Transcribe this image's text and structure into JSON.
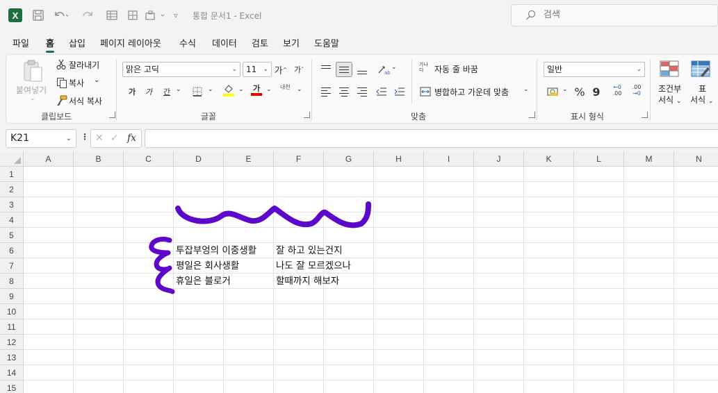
{
  "app": {
    "title": "통합 문서1  -  Excel",
    "logo_letter": "X",
    "search_placeholder": "검색"
  },
  "titlebar_icons": [
    "save-icon",
    "undo-icon",
    "redo-icon",
    "form-icon",
    "touch-mode-icon",
    "customize-icon"
  ],
  "tabs": [
    "파일",
    "홈",
    "삽입",
    "페이지 레이아웃",
    "수식",
    "데이터",
    "검토",
    "보기",
    "도움말"
  ],
  "active_tab": "홈",
  "ribbon": {
    "clipboard": {
      "paste": "붙여넣기",
      "cut": "잘라내기",
      "copy": "복사",
      "format_painter": "서식 복사",
      "label": "클립보드"
    },
    "font": {
      "font_name": "맑은 고딕",
      "font_size": "11",
      "grow": "가",
      "shrink": "가",
      "bold": "가",
      "italic": "가",
      "underline": "간",
      "font_color_glyph": "가",
      "phonetic": "내천",
      "label": "글꼴",
      "fill_color": "#ffff00",
      "font_color": "#e00000"
    },
    "alignment": {
      "wrap_text_glyph": "가나 다",
      "wrap_text": "자동 줄 바꿈",
      "merge_center": "병합하고 가운데 맞춤",
      "label": "맞춤"
    },
    "number": {
      "format": "일반",
      "percent": "%",
      "comma": "9",
      "inc_decimal": ".00",
      "dec_decimal": ".00",
      "label": "표시 형식"
    },
    "styles": {
      "conditional_line1": "조건부",
      "conditional_line2": "서식",
      "table_line1": "표",
      "table_line2": "서식"
    }
  },
  "formula_bar": {
    "name_box": "K21",
    "fx": "fx",
    "formula": ""
  },
  "grid": {
    "columns": [
      "A",
      "B",
      "C",
      "D",
      "E",
      "F",
      "G",
      "H",
      "I",
      "J",
      "K",
      "L",
      "M",
      "N"
    ],
    "rows": [
      "1",
      "2",
      "3",
      "4",
      "5",
      "6",
      "7",
      "8",
      "9",
      "10",
      "11",
      "12",
      "13",
      "14",
      "15"
    ],
    "cells": [
      {
        "ref": "D6",
        "text": "투잡부엉의 이중생활"
      },
      {
        "ref": "F6",
        "text": "잘 하고 있는건지"
      },
      {
        "ref": "D7",
        "text": "평일은 회사생활"
      },
      {
        "ref": "F7",
        "text": "나도 잘 모르겠으나"
      },
      {
        "ref": "D8",
        "text": "휴일은 블로거"
      },
      {
        "ref": "F8",
        "text": "할때까지 해보자"
      }
    ],
    "ink_color": "#5c07c9"
  }
}
